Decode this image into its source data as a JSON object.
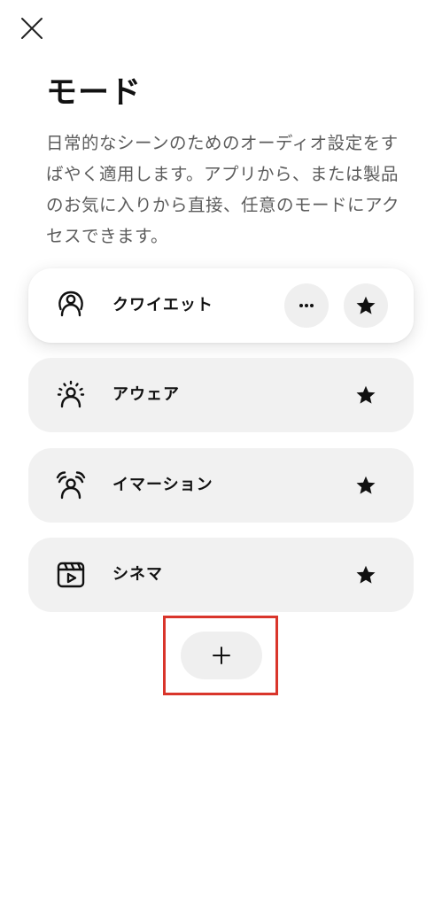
{
  "header": {
    "close_icon": "close-icon",
    "title": "モード",
    "description": "日常的なシーンのためのオーディオ設定をすばやく適用します。アプリから、または製品のお気に入りから直接、任意のモードにアクセスできます。"
  },
  "modes": [
    {
      "label": "クワイエット",
      "icon": "quiet-mode-icon",
      "active": true,
      "favorite": true
    },
    {
      "label": "アウェア",
      "icon": "aware-mode-icon",
      "active": false,
      "favorite": true
    },
    {
      "label": "イマーション",
      "icon": "immersion-mode-icon",
      "active": false,
      "favorite": true
    },
    {
      "label": "シネマ",
      "icon": "cinema-mode-icon",
      "active": false,
      "favorite": true
    }
  ],
  "actions": {
    "more_icon": "more-icon",
    "favorite_icon": "star-icon",
    "add_icon": "plus-icon"
  },
  "colors": {
    "highlight": "#d9352b",
    "card_background": "#f1f1f1",
    "active_card_background": "#ffffff",
    "text_primary": "#111111",
    "text_secondary": "#5c5c5c"
  }
}
